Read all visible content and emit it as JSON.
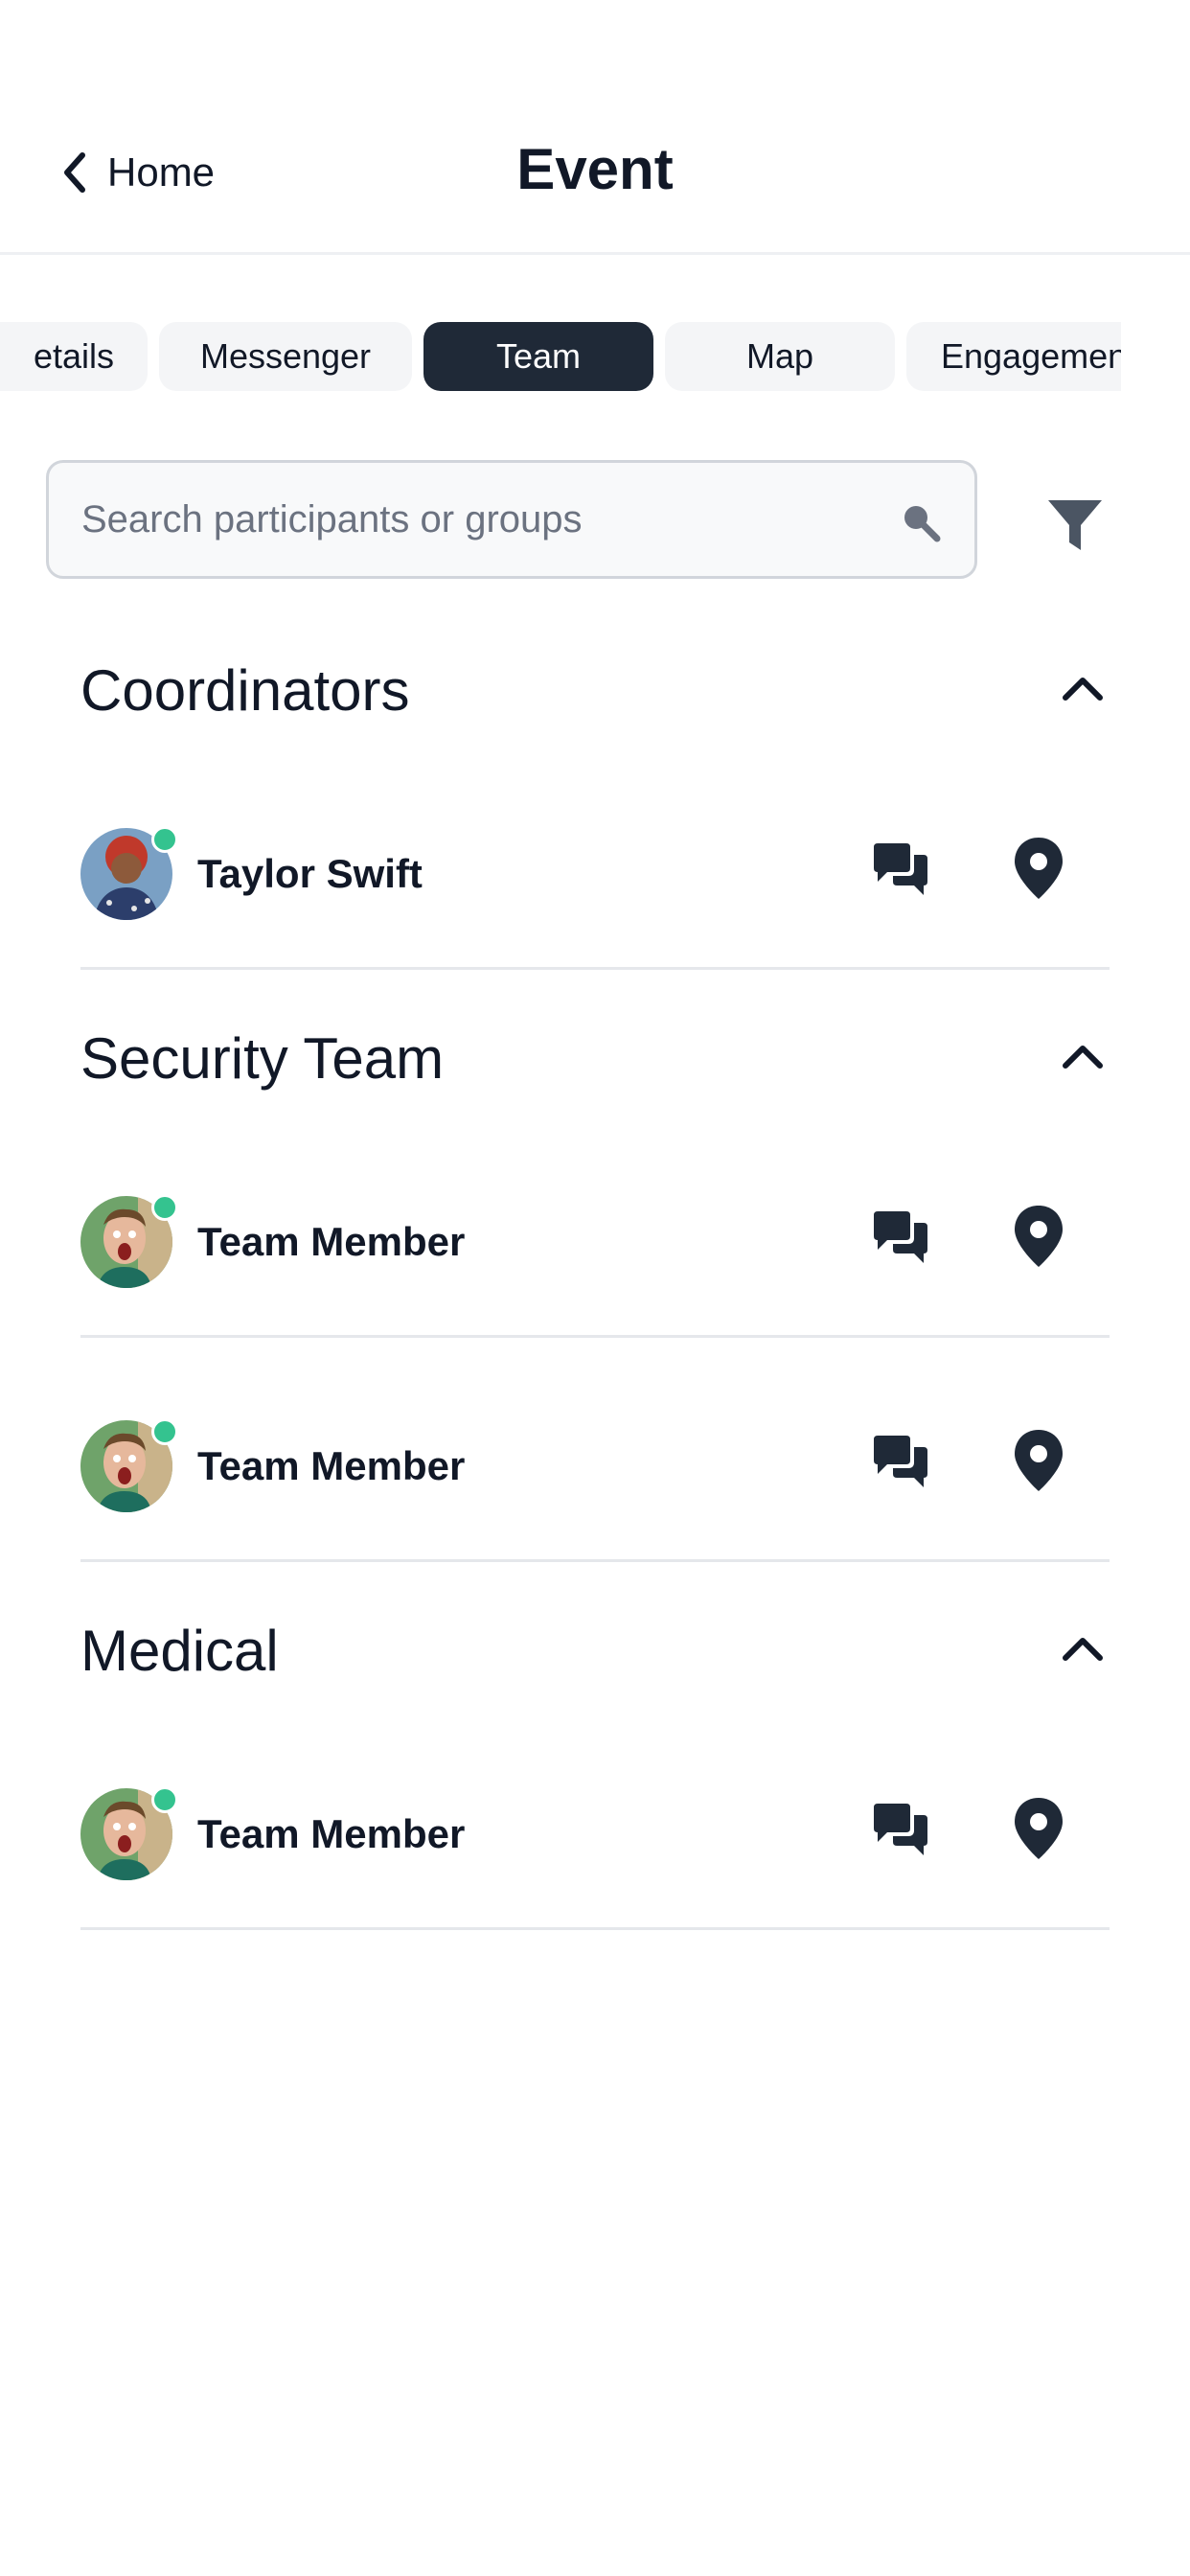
{
  "header": {
    "back_label": "Home",
    "title": "Event"
  },
  "tabs": [
    {
      "label": "etails",
      "active": false
    },
    {
      "label": "Messenger",
      "active": false
    },
    {
      "label": "Team",
      "active": true
    },
    {
      "label": "Map",
      "active": false
    },
    {
      "label": "Engagement",
      "active": false
    }
  ],
  "search": {
    "value": "",
    "placeholder": "Search participants or groups"
  },
  "groups": [
    {
      "title": "Coordinators",
      "members": [
        {
          "name": "Taylor Swift",
          "avatar": "woman-red-hair-avatar",
          "online": true
        }
      ]
    },
    {
      "title": "Security Team",
      "members": [
        {
          "name": "Team Member",
          "avatar": "surprised-man-avatar",
          "online": true
        },
        {
          "name": "Team Member",
          "avatar": "surprised-man-avatar",
          "online": true
        }
      ]
    },
    {
      "title": "Medical",
      "members": [
        {
          "name": "Team Member",
          "avatar": "surprised-man-avatar",
          "online": true
        }
      ]
    }
  ],
  "colors": {
    "active_tab": "#1f2937",
    "online": "#34c38f",
    "icon": "#1f2937"
  },
  "icons": {
    "back": "chevron-left-icon",
    "search": "search-icon",
    "filter": "filter-icon",
    "collapse": "chevron-up-icon",
    "message": "chat-bubbles-icon",
    "location": "map-pin-icon"
  }
}
